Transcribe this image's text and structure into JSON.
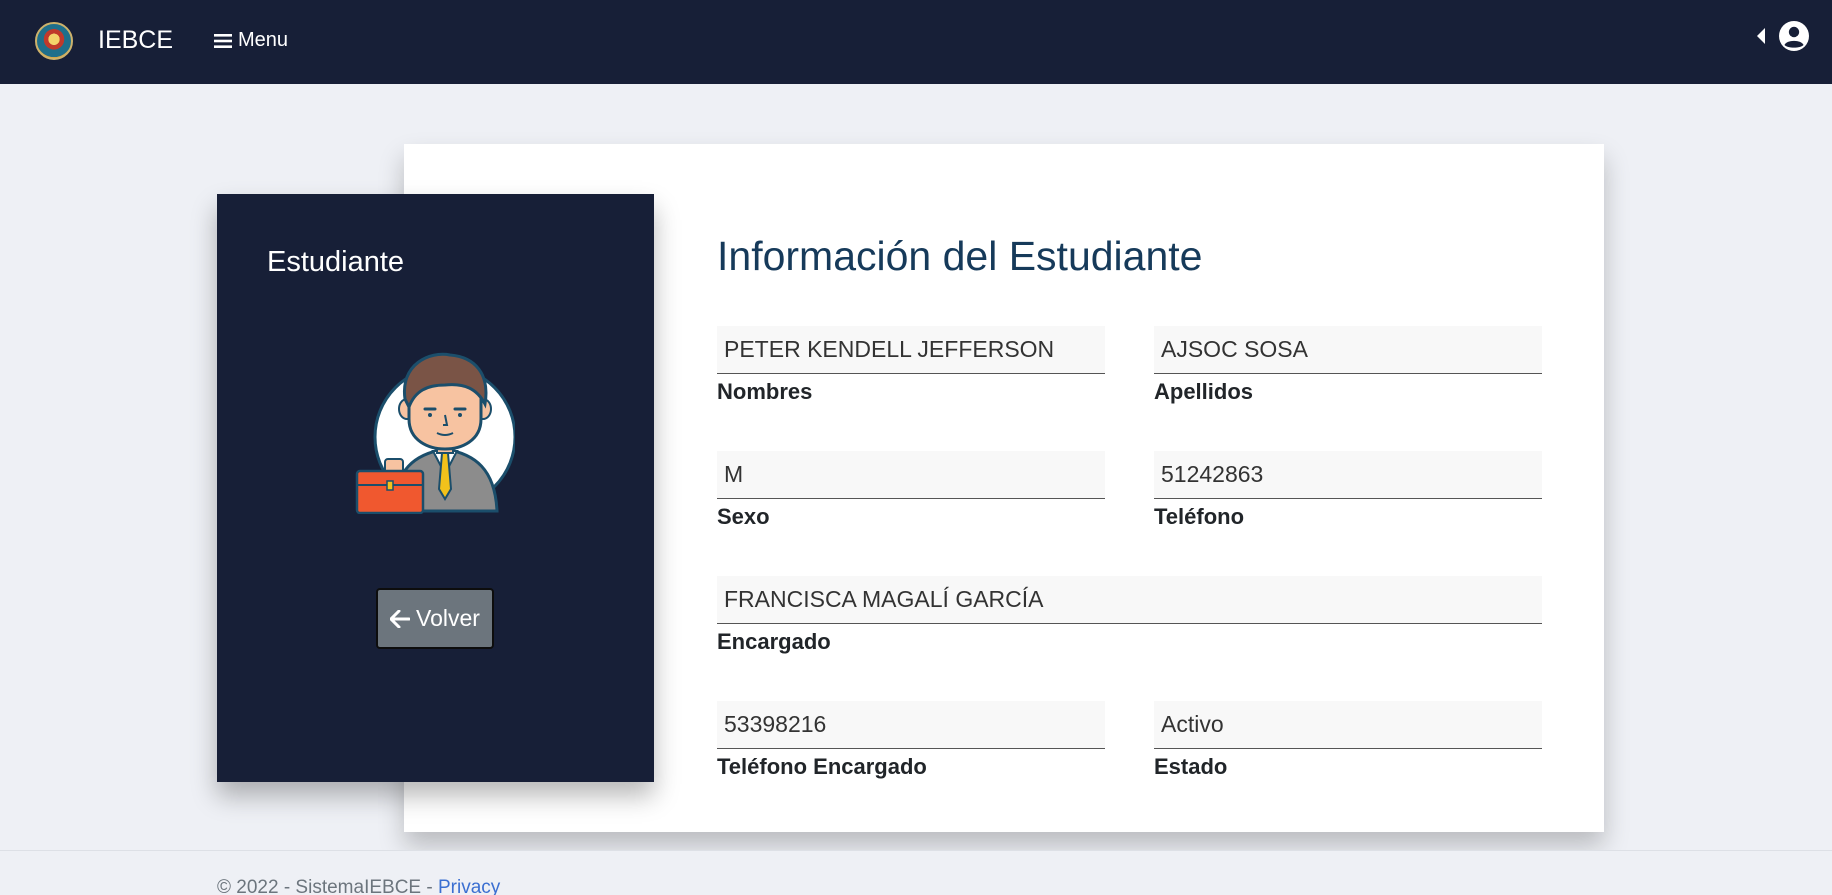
{
  "navbar": {
    "brand": "IEBCE",
    "menu_label": "Menu",
    "logo_icon": "school-crest-logo",
    "user_icon": "user-circle-icon",
    "caret_icon": "caret-left-icon"
  },
  "side_panel": {
    "title": "Estudiante",
    "back_label": "Volver",
    "back_icon": "arrow-left-icon"
  },
  "main": {
    "title": "Información del Estudiante",
    "fields": {
      "nombres": {
        "value": "PETER KENDELL JEFFERSON",
        "label": "Nombres"
      },
      "apellidos": {
        "value": "AJSOC SOSA",
        "label": "Apellidos"
      },
      "sexo": {
        "value": "M",
        "label": "Sexo"
      },
      "telefono": {
        "value": "51242863",
        "label": "Teléfono"
      },
      "encargado": {
        "value": "FRANCISCA MAGALÍ GARCÍA",
        "label": "Encargado"
      },
      "telefono_encargado": {
        "value": "53398216",
        "label": "Teléfono Encargado"
      },
      "estado": {
        "value": "Activo",
        "label": "Estado"
      }
    }
  },
  "footer": {
    "copyright": "© 2022 - SistemaIEBCE - ",
    "privacy_link": "Privacy"
  },
  "colors": {
    "navbar_bg": "#171f37",
    "page_bg": "#eef0f5",
    "title_color": "#163a5a",
    "button_bg": "#6c757d",
    "link_color": "#3b6fd1"
  }
}
